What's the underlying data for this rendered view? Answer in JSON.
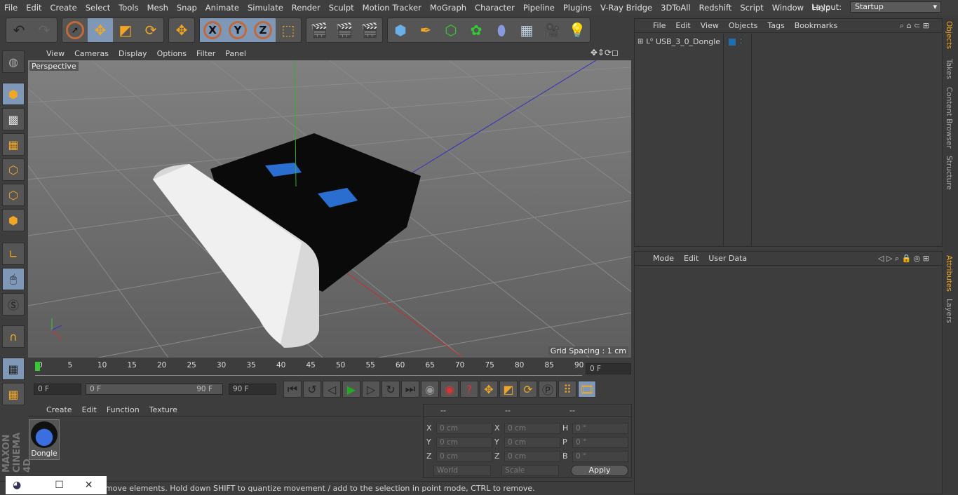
{
  "menu": [
    "File",
    "Edit",
    "Create",
    "Select",
    "Tools",
    "Mesh",
    "Snap",
    "Animate",
    "Simulate",
    "Render",
    "Sculpt",
    "Motion Tracker",
    "MoGraph",
    "Character",
    "Pipeline",
    "Plugins",
    "V-Ray Bridge",
    "3DToAll",
    "Redshift",
    "Script",
    "Window",
    "Help"
  ],
  "layout": {
    "label": "Layout:",
    "value": "Startup"
  },
  "toolbar": {
    "axes": [
      "X",
      "Y",
      "Z"
    ]
  },
  "viewport": {
    "menu": [
      "View",
      "Cameras",
      "Display",
      "Options",
      "Filter",
      "Panel"
    ],
    "camera": "Perspective",
    "grid_spacing": "Grid Spacing : 1 cm"
  },
  "timeline": {
    "ticks": [
      "0",
      "5",
      "10",
      "15",
      "20",
      "25",
      "30",
      "35",
      "40",
      "45",
      "50",
      "55",
      "60",
      "65",
      "70",
      "75",
      "80",
      "85",
      "90"
    ],
    "current_frame": "0 F",
    "start": "0 F",
    "range_start": "0 F",
    "range_end": "90 F",
    "end": "90 F"
  },
  "materials": {
    "menu": [
      "Create",
      "Edit",
      "Function",
      "Texture"
    ],
    "items": [
      {
        "name": "Dongle"
      }
    ]
  },
  "coordinates": {
    "headers": [
      "--",
      "--",
      "--"
    ],
    "rows": [
      {
        "l1": "X",
        "v1": "0 cm",
        "l2": "X",
        "v2": "0 cm",
        "l3": "H",
        "v3": "0 °"
      },
      {
        "l1": "Y",
        "v1": "0 cm",
        "l2": "Y",
        "v2": "0 cm",
        "l3": "P",
        "v3": "0 °"
      },
      {
        "l1": "Z",
        "v1": "0 cm",
        "l2": "Z",
        "v2": "0 cm",
        "l3": "B",
        "v3": "0 °"
      }
    ],
    "space": "World",
    "mode": "Scale",
    "apply": "Apply"
  },
  "status": "move elements. Hold down SHIFT to quantize movement / add to the selection in point mode, CTRL to remove.",
  "objects": {
    "menu": [
      "File",
      "Edit",
      "View",
      "Objects",
      "Tags",
      "Bookmarks"
    ],
    "items": [
      {
        "name": "USB_3_0_Dongle"
      }
    ]
  },
  "attributes": {
    "menu": [
      "Mode",
      "Edit",
      "User Data"
    ]
  },
  "side_tabs": [
    "Objects",
    "Takes",
    "Content Browser",
    "Structure",
    "Attributes",
    "Layers"
  ],
  "brand": "MAXON CINEMA 4D",
  "colors": {
    "accent": "#7f98b8",
    "icon": "#f2a623"
  }
}
